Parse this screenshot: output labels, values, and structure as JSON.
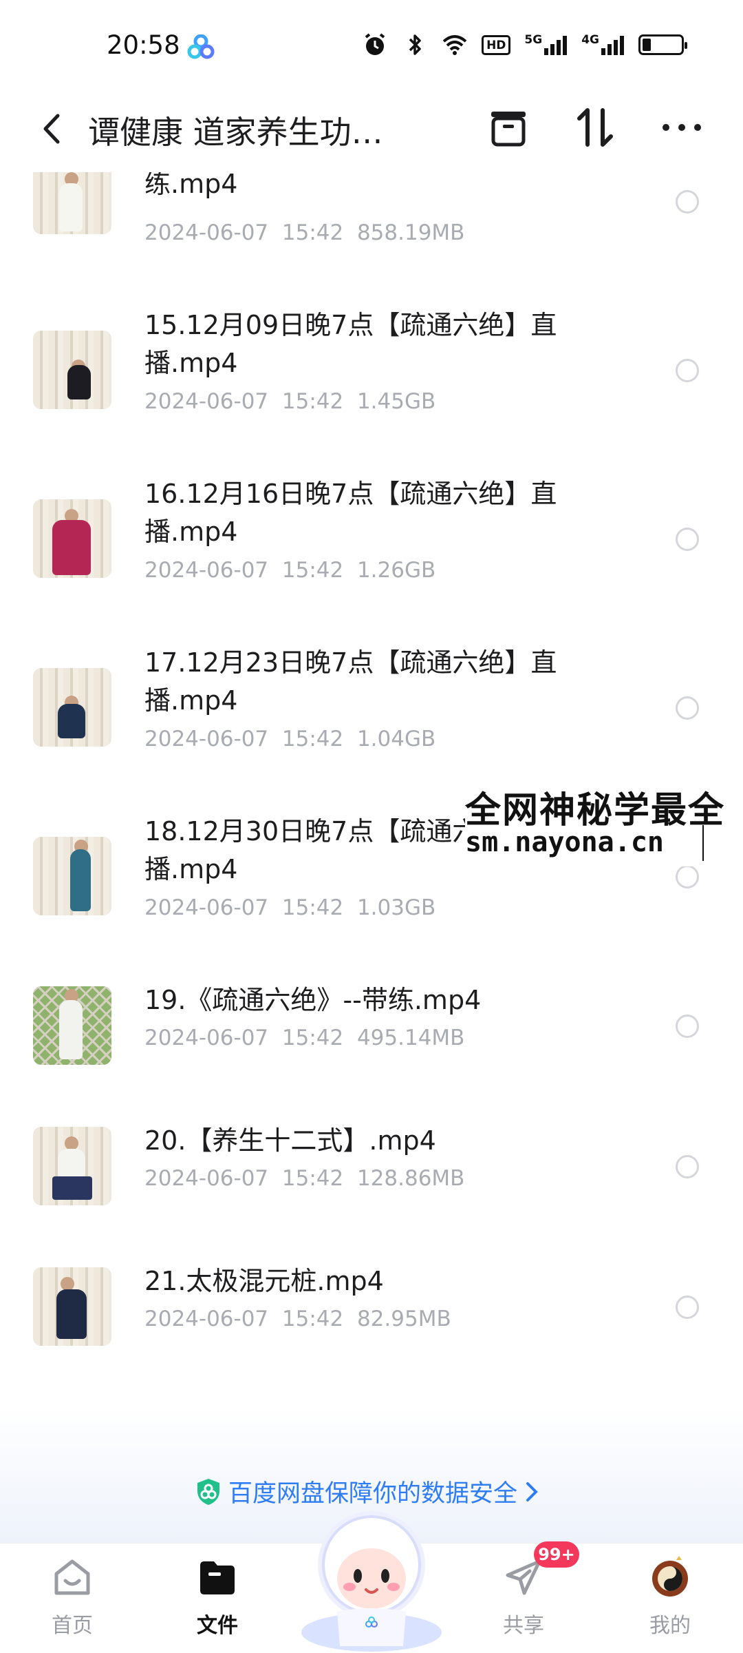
{
  "status_bar": {
    "time": "20:58",
    "hd_label": "HD",
    "net1": "5G",
    "net2": "4G",
    "icons": [
      "baidu-netdisk-icon",
      "alarm-icon",
      "bluetooth-icon",
      "wifi-icon",
      "hd-icon",
      "signal-icon",
      "signal-icon",
      "battery-icon"
    ]
  },
  "header": {
    "title": "谭健康 道家养生功…",
    "icons": [
      "back-icon",
      "manage-icon",
      "sort-icon",
      "more-icon"
    ]
  },
  "files": [
    {
      "name": "练.mp4",
      "date": "2024-06-07",
      "time": "15:42",
      "size": "858.19MB"
    },
    {
      "name": "15.12月09日晚7点【疏通六绝】直播.mp4",
      "date": "2024-06-07",
      "time": "15:42",
      "size": "1.45GB"
    },
    {
      "name": "16.12月16日晚7点【疏通六绝】直播.mp4",
      "date": "2024-06-07",
      "time": "15:42",
      "size": "1.26GB"
    },
    {
      "name": "17.12月23日晚7点【疏通六绝】直播.mp4",
      "date": "2024-06-07",
      "time": "15:42",
      "size": "1.04GB"
    },
    {
      "name": "18.12月30日晚7点【疏通六绝】直播.mp4",
      "date": "2024-06-07",
      "time": "15:42",
      "size": "1.03GB"
    },
    {
      "name": "19.《疏通六绝》--带练.mp4",
      "date": "2024-06-07",
      "time": "15:42",
      "size": "495.14MB"
    },
    {
      "name": "20.【养生十二式】.mp4",
      "date": "2024-06-07",
      "time": "15:42",
      "size": "128.86MB"
    },
    {
      "name": "21.太极混元桩.mp4",
      "date": "2024-06-07",
      "time": "15:42",
      "size": "82.95MB"
    }
  ],
  "watermark": {
    "line1": "全网神秘学最全",
    "line2": "sm.nayona.cn"
  },
  "banner": {
    "text": "百度网盘保障你的数据安全"
  },
  "nav": {
    "home": "首页",
    "files": "文件",
    "share": "共享",
    "mine": "我的",
    "share_badge": "99+"
  },
  "colors": {
    "accent": "#2f7df6",
    "badge": "#f4385c",
    "meta_text": "#a9abb2"
  }
}
